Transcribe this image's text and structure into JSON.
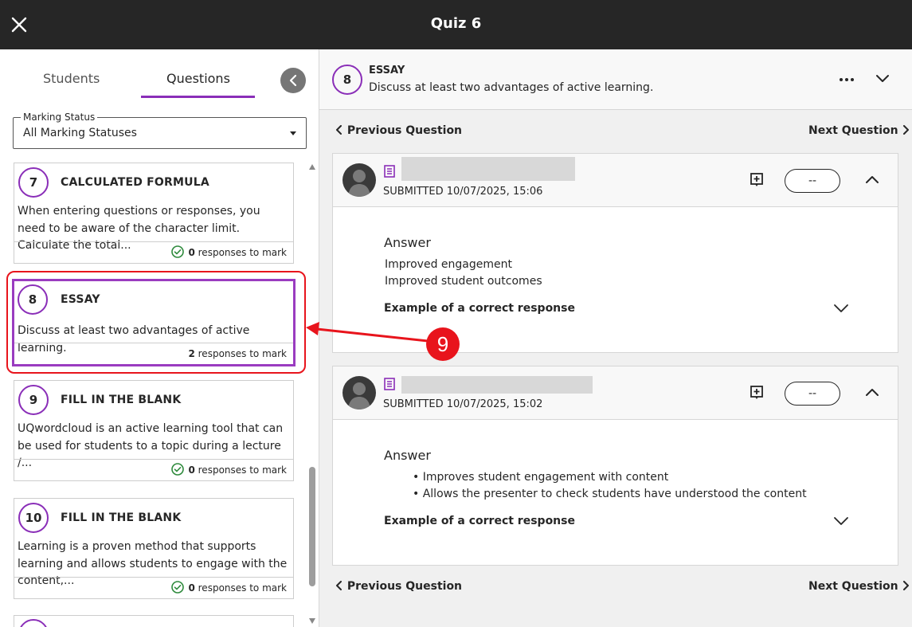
{
  "window": {
    "title": "Quiz 6"
  },
  "left_panel": {
    "tabs": [
      {
        "label": "Students"
      },
      {
        "label": "Questions",
        "selected": true
      }
    ],
    "filter": {
      "legend": "Marking Status",
      "value": "All Marking Statuses"
    },
    "questions": [
      {
        "number": "7",
        "type": "CALCULATED FORMULA",
        "text": "When entering questions or responses, you need to be aware of the character limit. Calculate the total...",
        "count": "0",
        "suffix": "responses to mark",
        "marked_complete": true
      },
      {
        "number": "8",
        "type": "ESSAY",
        "text": "Discuss at least two advantages of active learning.",
        "count": "2",
        "suffix": "responses to mark",
        "marked_complete": false,
        "selected": true
      },
      {
        "number": "9",
        "type": "FILL IN THE BLANK",
        "text": "UQwordcloud is an active learning tool that can be used for students to a topic during a lecture /...",
        "count": "0",
        "suffix": "responses to mark",
        "marked_complete": true
      },
      {
        "number": "10",
        "type": "FILL IN THE BLANK",
        "text": "Learning is a proven method that supports learning and allows students to engage with the content,...",
        "count": "0",
        "suffix": "responses to mark",
        "marked_complete": true
      }
    ]
  },
  "annotation": {
    "callout": "9",
    "color": "#e8141c"
  },
  "right_panel": {
    "question": {
      "number": "8",
      "type": "ESSAY",
      "text": "Discuss at least two advantages of active learning."
    },
    "nav": {
      "previous": "Previous Question",
      "next": "Next Question"
    },
    "responses": [
      {
        "submitted": "SUBMITTED 10/07/2025, 15:06",
        "grade": "--",
        "answer_title": "Answer",
        "answer_lines": [
          "Improved engagement",
          "Improved student outcomes"
        ],
        "correct_label": "Example of a correct response"
      },
      {
        "submitted": "SUBMITTED 10/07/2025, 15:02",
        "grade": "--",
        "answer_title": "Answer",
        "answer_lines": [
          "• Improves student engagement with content",
          "• Allows the presenter to check students have understood the content"
        ],
        "correct_label": "Example of a correct response"
      }
    ]
  },
  "colors": {
    "accent": "#8a2eb8",
    "titlebar": "#262626",
    "success": "#2e8a3c"
  }
}
